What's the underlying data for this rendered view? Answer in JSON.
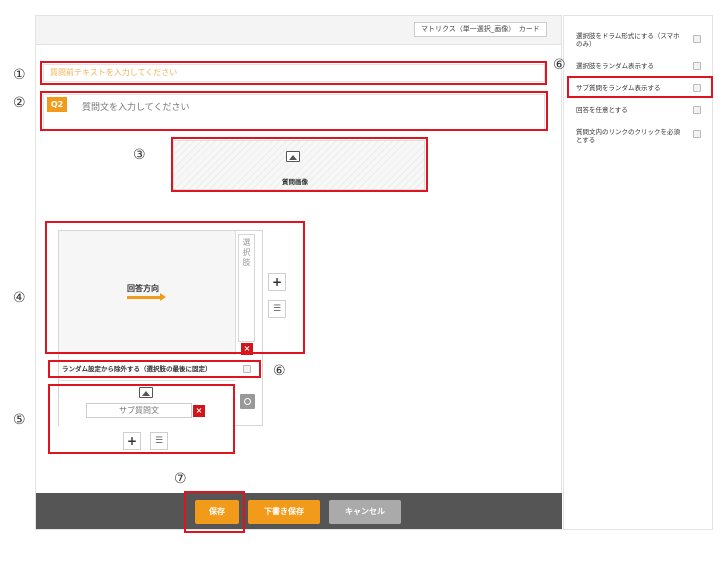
{
  "header": {
    "mode_label": "マトリクス（単一選択_画像）　カード"
  },
  "annotations": {
    "n1": "①",
    "n2": "②",
    "n3": "③",
    "n4": "④",
    "n5": "⑤",
    "n6a": "⑥",
    "n6b": "⑥",
    "n7": "⑦"
  },
  "question": {
    "pre_text_placeholder": "質問前テキストを入力してください",
    "badge": "Q2",
    "text_placeholder": "質問文を入力してください",
    "image_caption": "質問画像"
  },
  "matrix": {
    "answer_direction": "回答方向",
    "choice_label": "選択肢",
    "delete_glyph": "×",
    "add_glyph": "+",
    "list_glyph": "☰",
    "random_exclude_label": "ランダム設定から除外する（選択肢の最後に固定）",
    "sub_question_placeholder": "サブ質問文"
  },
  "footer": {
    "save_label": "保存",
    "draft_label": "下書き保存",
    "cancel_label": "キャンセル"
  },
  "settings": {
    "items": [
      {
        "label": "選択肢をドラム形式にする（スマホのみ）"
      },
      {
        "label": "選択肢をランダム表示する"
      },
      {
        "label": "サブ質問をランダム表示する"
      },
      {
        "label": "回答を任意とする"
      },
      {
        "label": "質問文内のリンクのクリックを必須とする"
      }
    ]
  },
  "colors": {
    "accent": "#f29a1a",
    "highlight_red": "#e0141e",
    "footer_bg": "#555555"
  }
}
